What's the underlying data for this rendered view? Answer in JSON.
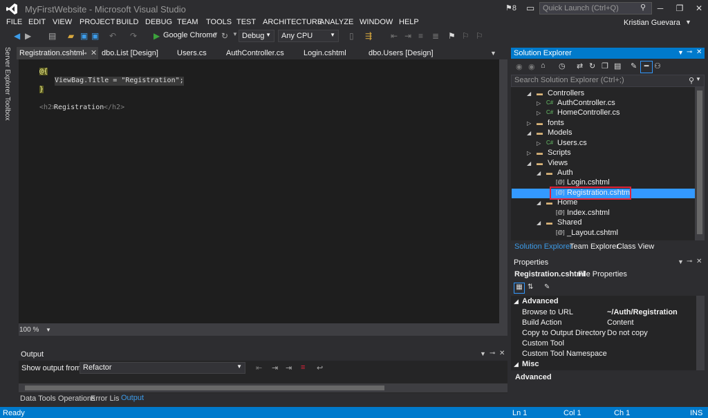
{
  "window": {
    "title": "MyFirstWebsite - Microsoft Visual Studio",
    "notifications": "8",
    "quick_launch_placeholder": "Quick Launch (Ctrl+Q)",
    "user": "Kristian Guevara"
  },
  "menu": [
    "FILE",
    "EDIT",
    "VIEW",
    "PROJECT",
    "BUILD",
    "DEBUG",
    "TEAM",
    "TOOLS",
    "TEST",
    "ARCHITECTURE",
    "ANALYZE",
    "WINDOW",
    "HELP"
  ],
  "toolbar": {
    "browser": "Google Chrome",
    "config": "Debug",
    "platform": "Any CPU"
  },
  "side_tabs": [
    "Server Explorer",
    "Toolbox"
  ],
  "doc_tabs": [
    "Registration.cshtml",
    "dbo.List [Design]",
    "Users.cs",
    "AuthController.cs",
    "Login.cshtml",
    "dbo.Users [Design]"
  ],
  "editor": {
    "line1": "@{",
    "line2": "ViewBag.Title = \"Registration\";",
    "line3": "}",
    "line5_open": "<h2>",
    "line5_text": "Registration",
    "line5_close": "</h2>",
    "zoom": "100 %"
  },
  "output": {
    "title": "Output",
    "show_from_label": "Show output from:",
    "source": "Refactor"
  },
  "bottom_tabs": [
    "Data Tools Operations",
    "Error List",
    "Output"
  ],
  "solution_explorer": {
    "title": "Solution Explorer",
    "search_placeholder": "Search Solution Explorer (Ctrl+;)",
    "tree": [
      {
        "label": "Controllers",
        "type": "folder",
        "expanded": true
      },
      {
        "label": "AuthController.cs",
        "type": "cs"
      },
      {
        "label": "HomeController.cs",
        "type": "cs"
      },
      {
        "label": "fonts",
        "type": "folder",
        "expanded": false
      },
      {
        "label": "Models",
        "type": "folder",
        "expanded": true
      },
      {
        "label": "Users.cs",
        "type": "cs"
      },
      {
        "label": "Scripts",
        "type": "folder",
        "expanded": false
      },
      {
        "label": "Views",
        "type": "folder",
        "expanded": true
      },
      {
        "label": "Auth",
        "type": "folder",
        "expanded": true
      },
      {
        "label": "Login.cshtml",
        "type": "cshtml"
      },
      {
        "label": "Registration.cshtml",
        "type": "cshtml",
        "selected": true
      },
      {
        "label": "Home",
        "type": "folder",
        "expanded": true
      },
      {
        "label": "Index.cshtml",
        "type": "cshtml"
      },
      {
        "label": "Shared",
        "type": "folder",
        "expanded": true
      },
      {
        "label": "_Layout.cshtml",
        "type": "cshtml"
      }
    ],
    "bottom_tabs": [
      "Solution Explorer",
      "Team Explorer",
      "Class View"
    ]
  },
  "properties": {
    "title": "Properties",
    "object": "Registration.cshtml",
    "object_type": "File Properties",
    "section_advanced": "Advanced",
    "rows": [
      {
        "name": "Browse to URL",
        "value": "~/Auth/Registration"
      },
      {
        "name": "Build Action",
        "value": "Content"
      },
      {
        "name": "Copy to Output Directory",
        "value": "Do not copy"
      },
      {
        "name": "Custom Tool",
        "value": ""
      },
      {
        "name": "Custom Tool Namespace",
        "value": ""
      }
    ],
    "section_misc": "Misc",
    "description_title": "Advanced"
  },
  "status": {
    "ready": "Ready",
    "ln": "Ln 1",
    "col": "Col 1",
    "ch": "Ch 1",
    "mode": "INS"
  },
  "colors": {
    "accent": "#007acc",
    "selection": "#3399ff",
    "highlight_box": "#e0233a"
  }
}
